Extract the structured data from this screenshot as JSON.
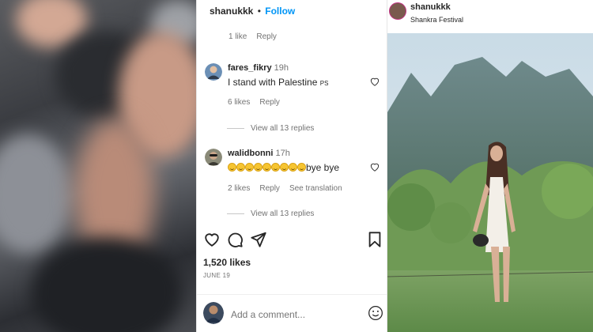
{
  "left_panel": {
    "image": "blurred-crowd-photo"
  },
  "post": {
    "header": {
      "username": "shanukkk",
      "separator": "•",
      "follow_label": "Follow"
    },
    "top_meta": {
      "likes": "1 like",
      "reply": "Reply"
    },
    "comments": [
      {
        "username": "fares_fikry",
        "time": "19h",
        "text": "I stand with Palestine",
        "flag": "PS",
        "likes": "6 likes",
        "reply": "Reply",
        "view_replies": "View all 13 replies"
      },
      {
        "username": "walidbonni",
        "time": "17h",
        "emoji_count": 9,
        "text": "bye bye",
        "likes": "2 likes",
        "reply": "Reply",
        "translation": "See translation",
        "view_replies": "View all 13 replies"
      }
    ],
    "actions": {
      "like": "heart-icon",
      "comment": "comment-icon",
      "share": "share-icon",
      "save": "bookmark-icon"
    },
    "likes_count": "1,520 likes",
    "date": "JUNE 19",
    "add_comment_placeholder": "Add a comment..."
  },
  "right_panel": {
    "username": "shanukkk",
    "location": "Shankra Festival",
    "image": "woman-in-mountain-meadow-photo"
  },
  "colors": {
    "follow": "#0095f6",
    "secondary_text": "#737373",
    "story_ring": "#c13584"
  }
}
